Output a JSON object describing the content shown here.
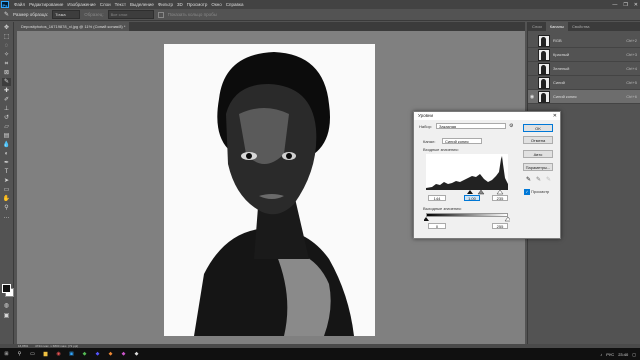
{
  "menu": {
    "app_badge": "Ps",
    "items": [
      "Файл",
      "Редактирование",
      "Изображение",
      "Слои",
      "Текст",
      "Выделение",
      "Фильтр",
      "3D",
      "Просмотр",
      "Окно",
      "Справка"
    ],
    "window_buttons": [
      "—",
      "❐",
      "✕"
    ]
  },
  "options_bar": {
    "sample_size_label": "Размер образца:",
    "sample_size_value": "Точка",
    "sample_label": "Образец:",
    "sample_value": "Все слои",
    "ring_label": "Показать кольцо пробы"
  },
  "document": {
    "tab_title": "Depositphotos_16719878_xl.jpg @ 11% (Синий копия/8) *",
    "zoom_status": "16,86%",
    "doc_status": "4744 пикс. х 6800 пикс. (72 ppi)"
  },
  "panels": {
    "tabs": [
      "Слои",
      "Каналы",
      "Свойства"
    ],
    "active_tab": "Каналы",
    "channels": [
      {
        "name": "RGB",
        "shortcut": "Ctrl+2"
      },
      {
        "name": "Красный",
        "shortcut": "Ctrl+3"
      },
      {
        "name": "Зеленый",
        "shortcut": "Ctrl+4"
      },
      {
        "name": "Синий",
        "shortcut": "Ctrl+5"
      },
      {
        "name": "Синий копия",
        "shortcut": "Ctrl+6"
      }
    ]
  },
  "levels_dialog": {
    "title": "Уровни",
    "preset_label": "Набор:",
    "preset_value": "Заказная",
    "channel_label": "Канал:",
    "channel_value": "Синий копия",
    "input_label": "Входные значения:",
    "input_black": "144",
    "input_gamma": "1,00",
    "input_white": "235",
    "output_label": "Выходные значения:",
    "output_black": "0",
    "output_white": "255",
    "buttons": {
      "ok": "OK",
      "cancel": "Отмена",
      "auto": "Авто",
      "options": "Параметры..."
    },
    "preview_label": "Просмотр",
    "preview_checked": true
  },
  "taskbar": {
    "lang": "РУС",
    "time": "23:40",
    "date": "16.01.2020"
  },
  "icons": {
    "menu_min": "minimize-icon",
    "menu_max": "maximize-icon",
    "menu_close": "close-icon"
  }
}
